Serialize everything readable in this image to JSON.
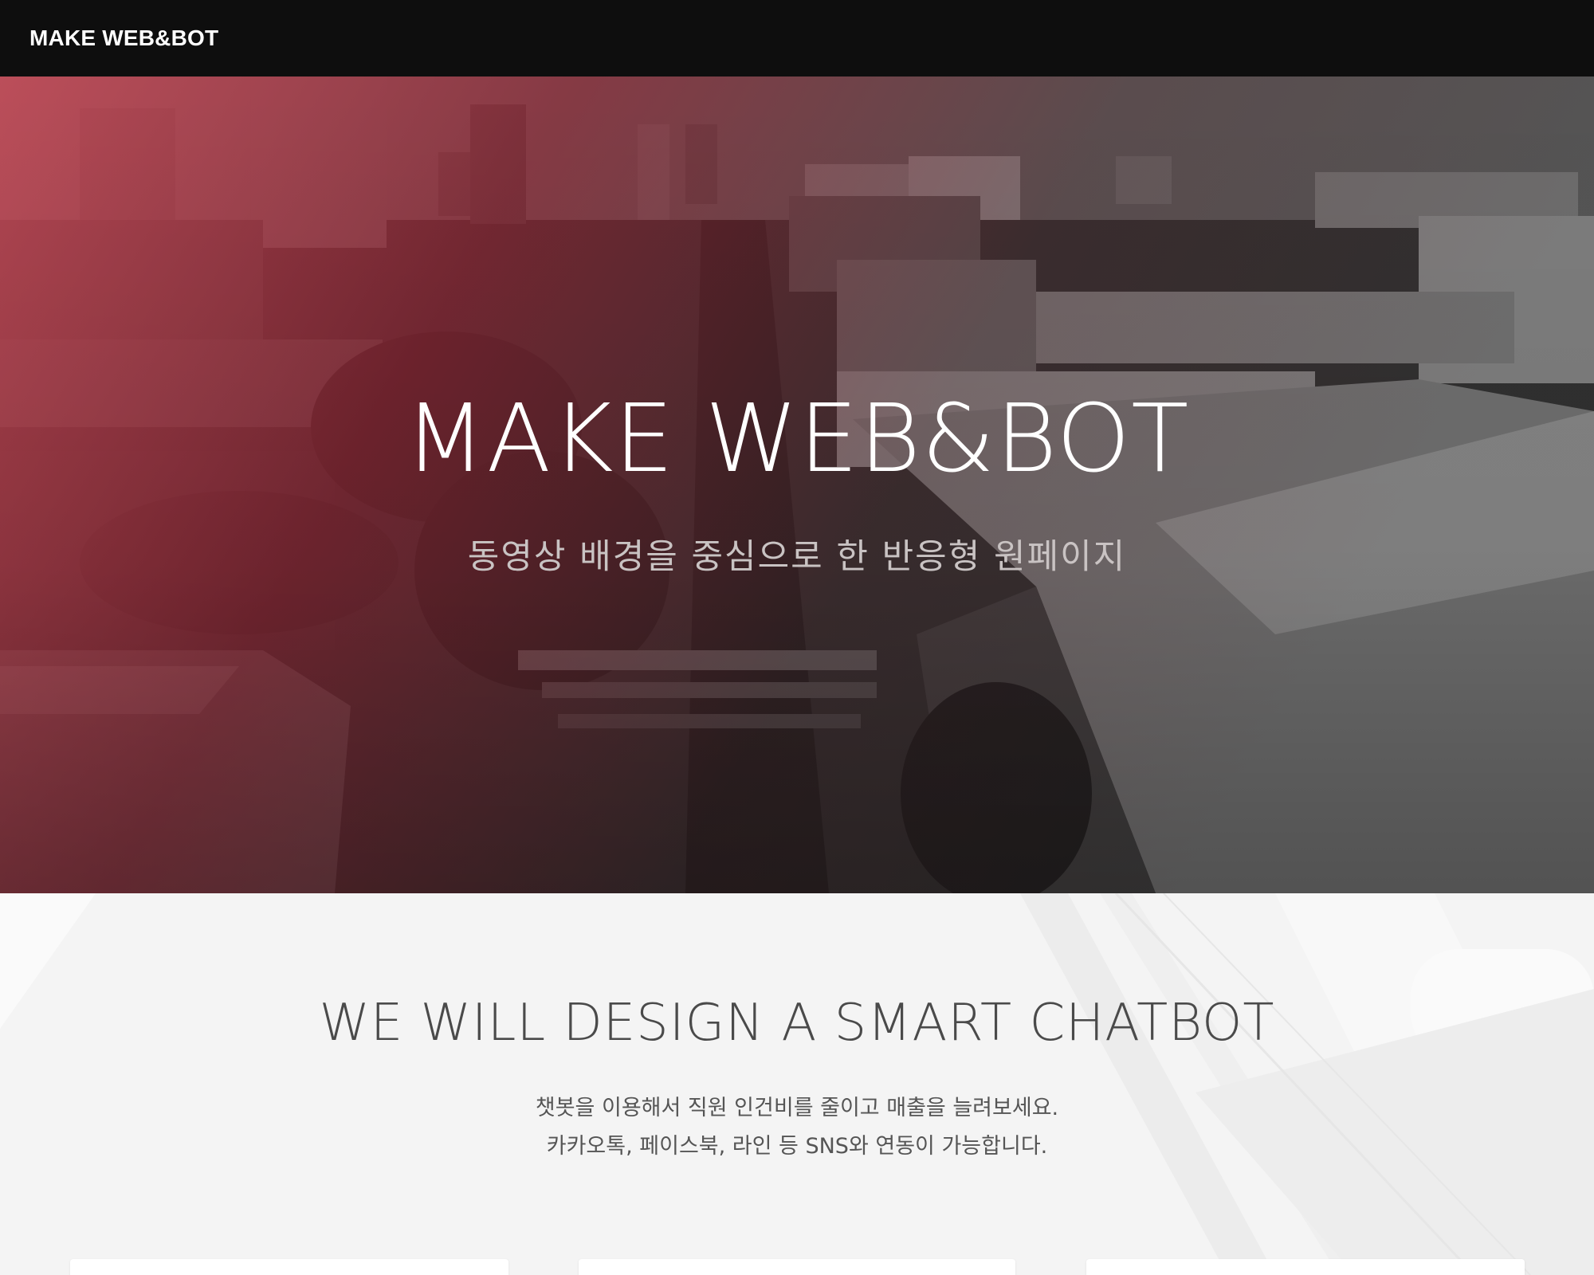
{
  "navbar": {
    "brand": "MAKE WEB&BOT"
  },
  "hero": {
    "title": "MAKE WEB&BOT",
    "subtitle": "동영상 배경을 중심으로 한 반응형 원페이지"
  },
  "intro": {
    "title": "WE WILL DESIGN A SMART CHATBOT",
    "lines": [
      "챗봇을 이용해서 직원 인건비를 줄이고 매출을 늘려보세요.",
      "카카오톡, 페이스북, 라인 등 SNS와 연동이 가능합니다."
    ]
  },
  "colors": {
    "navbar": "#0e0e0e",
    "accent_red": "#c0394a",
    "text_dark": "#4a4a4a"
  }
}
